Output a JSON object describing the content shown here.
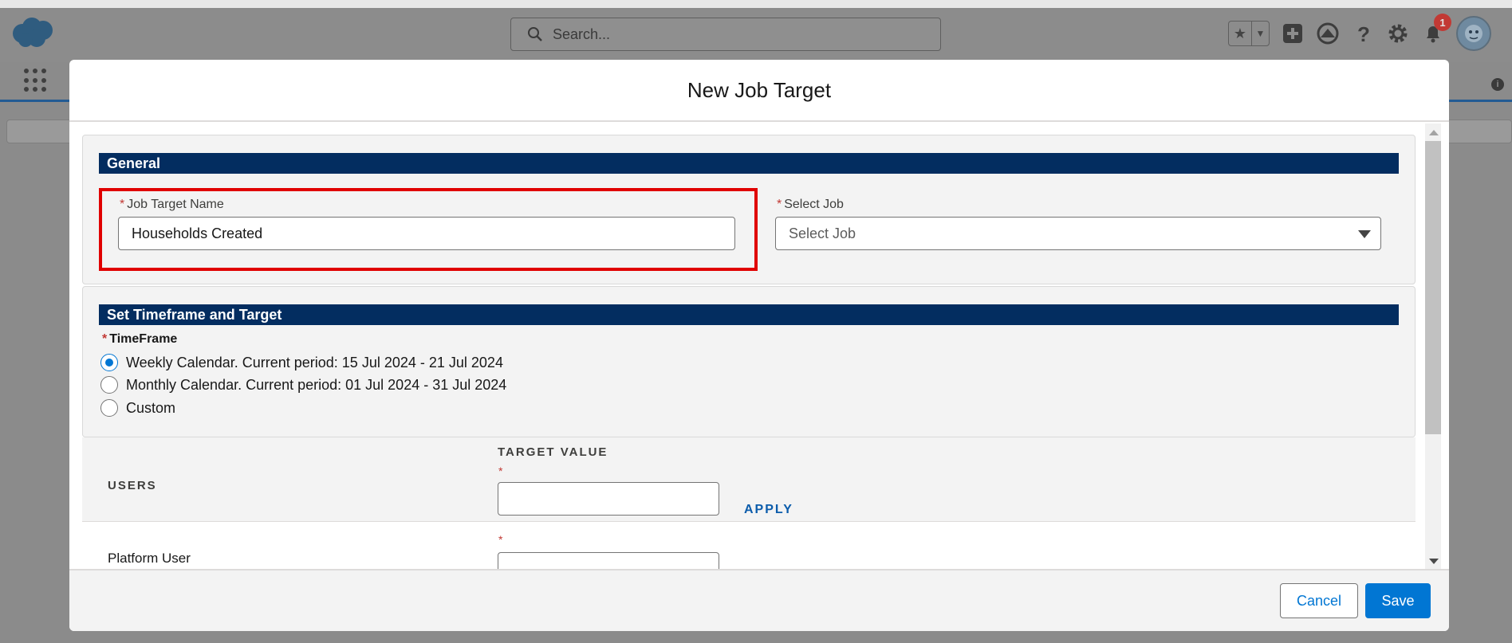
{
  "header": {
    "search_placeholder": "Search...",
    "notification_count": "1",
    "icons": [
      "cloud-logo",
      "search-icon",
      "star-icon",
      "chevron-down-icon",
      "add-icon",
      "trailhead-icon",
      "help-icon",
      "gear-icon",
      "bell-icon",
      "avatar",
      "app-launcher-icon",
      "info-icon"
    ]
  },
  "modal": {
    "title": "New Job Target",
    "general": {
      "section_title": "General",
      "job_target_name_label": "Job Target Name",
      "job_target_name_value": "Households Created",
      "select_job_label": "Select Job",
      "select_job_placeholder": "Select Job"
    },
    "timeframe": {
      "section_title": "Set Timeframe and Target",
      "label": "TimeFrame",
      "options": [
        {
          "label": "Weekly Calendar. Current period: 15 Jul 2024 - 21 Jul 2024",
          "selected": true
        },
        {
          "label": "Monthly Calendar. Current period: 01 Jul 2024 - 31 Jul 2024",
          "selected": false
        },
        {
          "label": "Custom",
          "selected": false
        }
      ]
    },
    "table": {
      "col_users": "USERS",
      "col_target_value": "TARGET VALUE",
      "required_marker": "*",
      "apply_label": "APPLY",
      "rows": [
        {
          "user": "Platform User",
          "target_value": ""
        }
      ]
    },
    "footer": {
      "cancel_label": "Cancel",
      "save_label": "Save"
    }
  },
  "colors": {
    "section_bar": "#032d60",
    "brand_blue": "#0176d3",
    "highlight_red": "#e00000",
    "required_red": "#c23934"
  }
}
